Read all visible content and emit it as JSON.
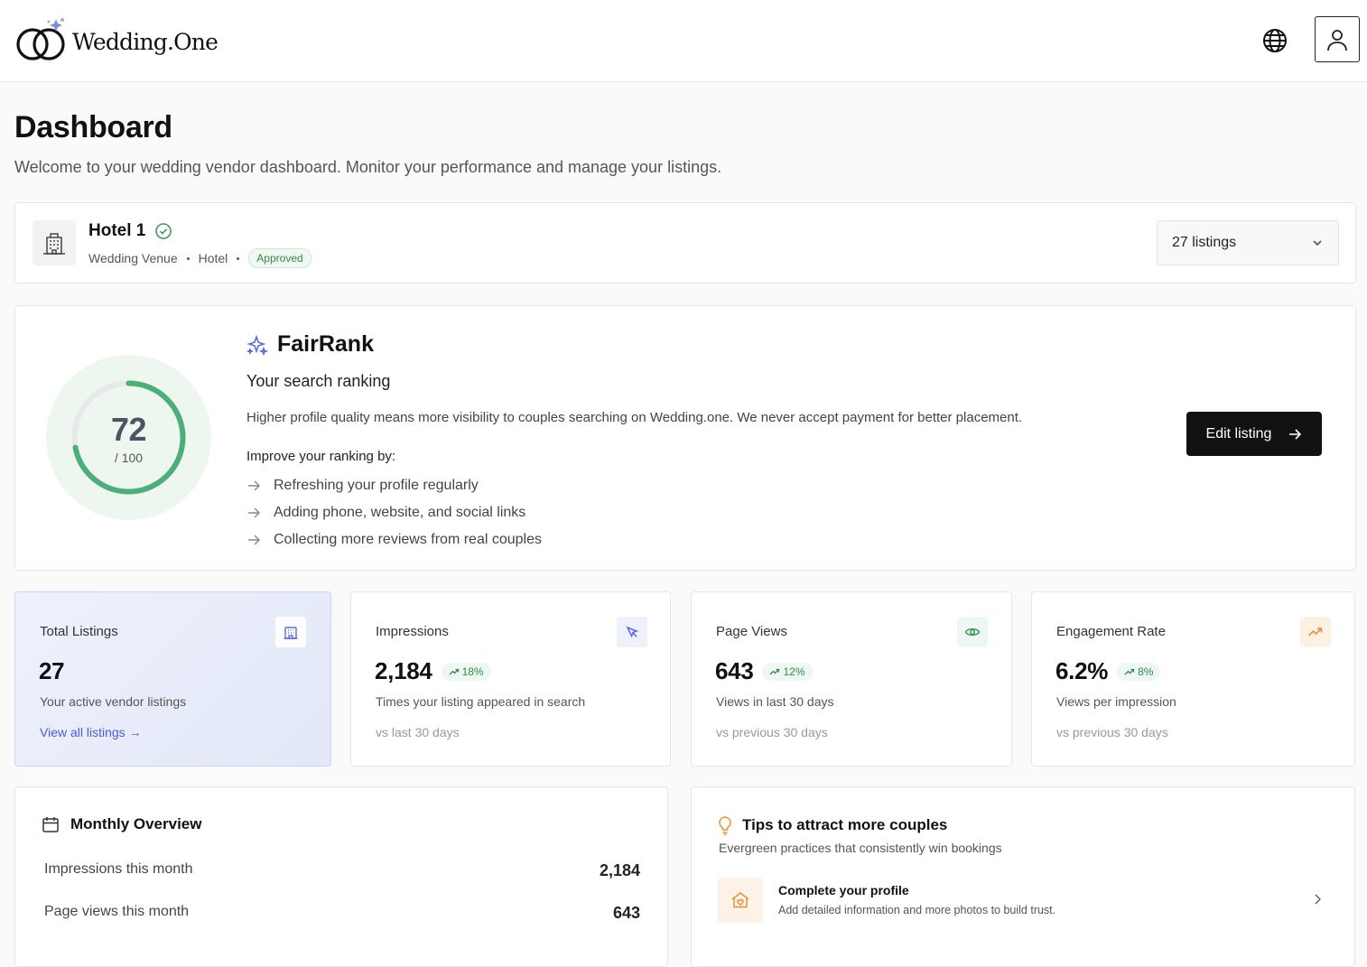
{
  "brand": {
    "name": "Wedding.One"
  },
  "header": {
    "globe_icon": "globe-icon",
    "user_icon": "user-icon"
  },
  "page": {
    "title": "Dashboard",
    "subtitle": "Welcome to your wedding vendor dashboard. Monitor your performance and manage your listings."
  },
  "listing": {
    "name": "Hotel 1",
    "category": "Wedding Venue",
    "type": "Hotel",
    "status": "Approved",
    "selector_value": "27 listings"
  },
  "fairrank": {
    "title": "FairRank",
    "subtitle": "Your search ranking",
    "score": "72",
    "score_max": "/ 100",
    "score_fraction": 0.72,
    "description": "Higher profile quality means more visibility to couples searching on Wedding.one. We never accept payment for better placement.",
    "improve_label": "Improve your ranking by:",
    "tips": [
      "Refreshing your profile regularly",
      "Adding phone, website, and social links",
      "Collecting more reviews from real couples"
    ],
    "edit_button": "Edit listing"
  },
  "stats": [
    {
      "label": "Total Listings",
      "value": "27",
      "desc": "Your active vendor listings",
      "link": "View all listings →",
      "icon": "building-icon"
    },
    {
      "label": "Impressions",
      "value": "2,184",
      "change": "18%",
      "desc": "Times your listing appeared in search",
      "foot": "vs last 30 days",
      "icon": "cursor-icon"
    },
    {
      "label": "Page Views",
      "value": "643",
      "change": "12%",
      "desc": "Views in last 30 days",
      "foot": "vs previous 30 days",
      "icon": "eye-icon"
    },
    {
      "label": "Engagement Rate",
      "value": "6.2%",
      "change": "8%",
      "desc": "Views per impression",
      "foot": "vs previous 30 days",
      "icon": "trending-up-icon"
    }
  ],
  "monthly": {
    "title": "Monthly Overview",
    "rows": [
      {
        "label": "Impressions this month",
        "value": "2,184"
      },
      {
        "label": "Page views this month",
        "value": "643"
      }
    ]
  },
  "tips": {
    "title": "Tips to attract more couples",
    "subtitle": "Evergreen practices that consistently win bookings",
    "items": [
      {
        "title": "Complete your profile",
        "desc": "Add detailed information and more photos to build trust."
      }
    ]
  },
  "colors": {
    "accent_green": "#4caf7a",
    "gauge_bg": "#eef7ef",
    "dark_button": "#111111",
    "link_blue": "#4b5bd6",
    "indigo_icon": "#5b6bd8",
    "orange_icon": "#e8913a"
  }
}
